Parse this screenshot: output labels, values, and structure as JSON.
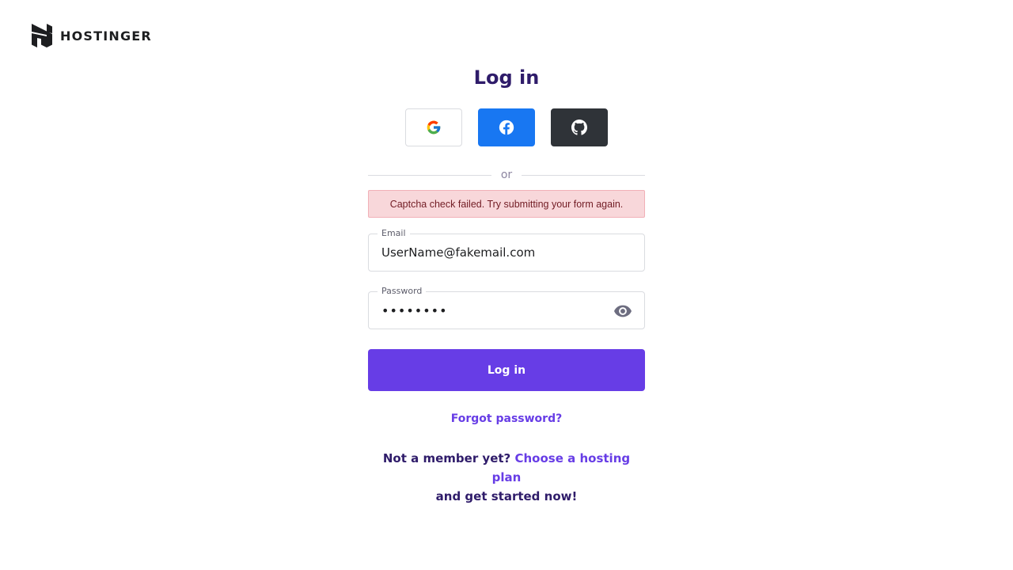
{
  "brand": {
    "name": "HOSTINGER",
    "logo_icon": "hostinger-h-logo-icon"
  },
  "login": {
    "title": "Log in",
    "social": [
      {
        "name": "google",
        "icon": "google-icon",
        "color": "#ffffff"
      },
      {
        "name": "facebook",
        "icon": "facebook-icon",
        "color": "#1877f2"
      },
      {
        "name": "github",
        "icon": "github-icon",
        "color": "#2f3338"
      }
    ],
    "divider_text": "or",
    "alert_message": "Captcha check failed. Try submitting your form again.",
    "email": {
      "label": "Email",
      "value": "UserName@fakemail.com"
    },
    "password": {
      "label": "Password",
      "value": "••••••••",
      "toggle_icon": "eye-icon"
    },
    "submit_label": "Log in",
    "forgot_link": "Forgot password?",
    "signup": {
      "prefix": "Not a member yet?",
      "link": "Choose a hosting plan",
      "suffix": "and get started now!"
    }
  },
  "colors": {
    "primary": "#673de6",
    "heading": "#2f1c6a",
    "alert_bg": "#f8d7da",
    "alert_text": "#721c24"
  }
}
